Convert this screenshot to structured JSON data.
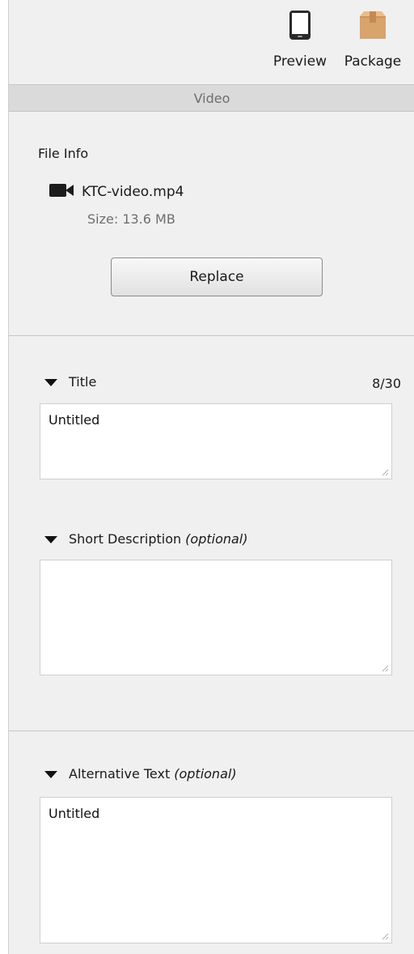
{
  "toolbar": {
    "preview_label": "Preview",
    "package_label": "Package",
    "preview_icon": "phone-icon",
    "package_icon": "package-box-icon"
  },
  "section": {
    "title": "Video"
  },
  "file_info": {
    "heading": "File Info",
    "file_icon": "video-camera-icon",
    "file_name": "KTC-video.mp4",
    "size_text": "Size: 13.6 MB",
    "replace_label": "Replace"
  },
  "title_field": {
    "label": "Title",
    "counter": "8/30",
    "value": "Untitled"
  },
  "short_description_field": {
    "label": "Short Description",
    "optional": "(optional)",
    "value": ""
  },
  "alt_text_field": {
    "label": "Alternative Text",
    "optional": "(optional)",
    "value": "Untitled"
  },
  "colors": {
    "panel_bg": "#f0f0f0",
    "section_bar_bg": "#dadada",
    "package_box": "#d9a36c"
  }
}
